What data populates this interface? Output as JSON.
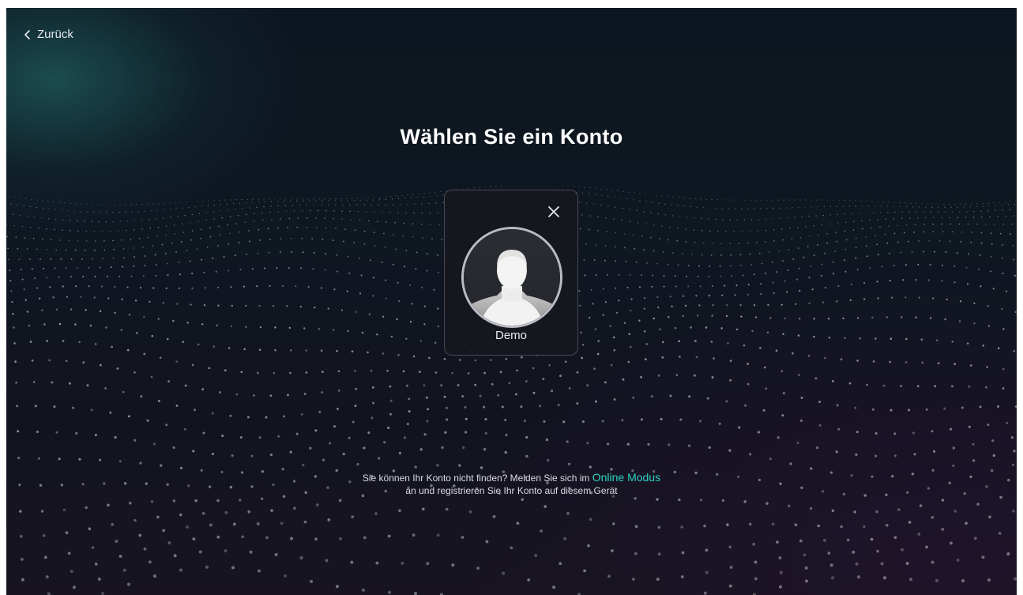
{
  "nav": {
    "back_label": "Zurück"
  },
  "page": {
    "title": "Wählen Sie ein Konto"
  },
  "accounts": [
    {
      "name": "Demo"
    }
  ],
  "hint": {
    "line1_prefix": "Sie können Ihr Konto nicht finden? Melden Sie sich im ",
    "link_label": "Online Modus",
    "line2": "an und registrieren Sie Ihr Konto auf diesem Gerät"
  },
  "colors": {
    "accent": "#2ed3c4",
    "background": "#0f1721",
    "card": "#16171e",
    "text": "#ffffff"
  },
  "icons": {
    "back": "chevron-left-icon",
    "remove_account": "close-icon",
    "avatar": "user-avatar-icon"
  }
}
